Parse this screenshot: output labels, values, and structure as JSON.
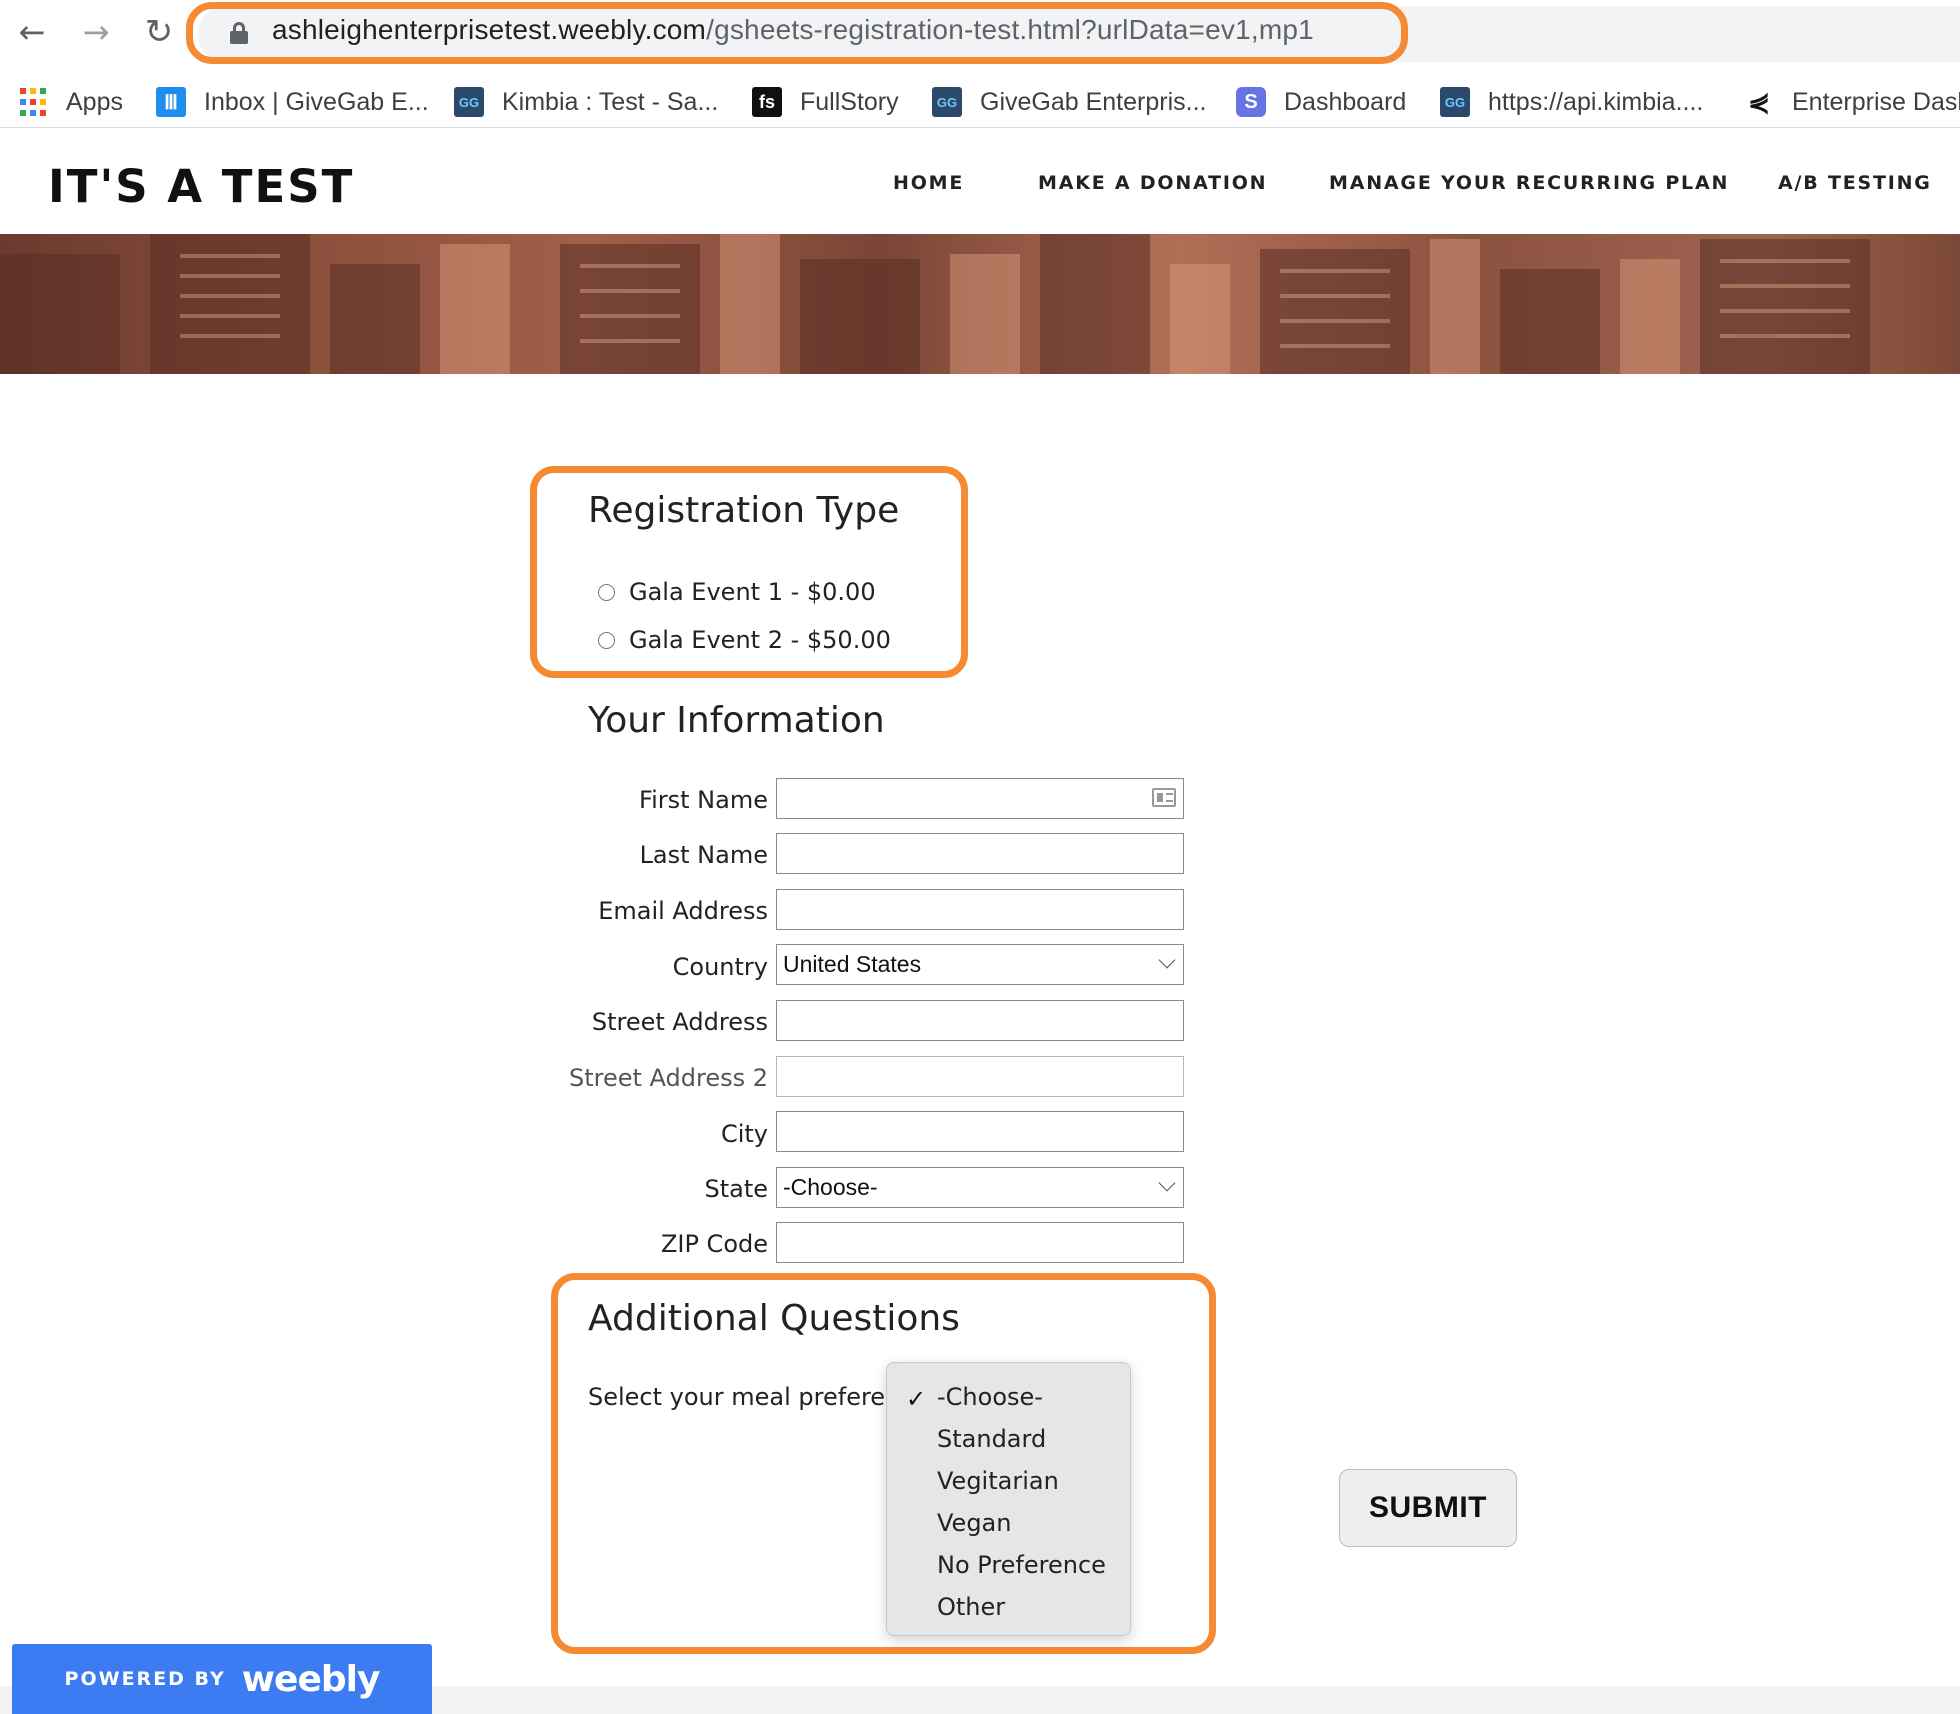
{
  "browser": {
    "url_domain": "ashleighenterprisetest.weebly.com",
    "url_path": "/gsheets-registration-test.html?urlData=ev1,mp1",
    "bookmarks": [
      {
        "label": "Apps",
        "icon": "apps-grid-icon"
      },
      {
        "label": "Inbox | GiveGab E...",
        "icon": "intercom-icon"
      },
      {
        "label": "Kimbia : Test - Sa...",
        "icon": "givegab-icon"
      },
      {
        "label": "FullStory",
        "icon": "fullstory-icon"
      },
      {
        "label": "GiveGab Enterpris...",
        "icon": "givegab-icon"
      },
      {
        "label": "Dashboard",
        "icon": "stripe-icon"
      },
      {
        "label": "https://api.kimbia....",
        "icon": "givegab-icon"
      },
      {
        "label": "Enterprise Dash",
        "icon": "enterprise-icon"
      }
    ],
    "icon_glyphs": {
      "intercom": "Ⅲ",
      "givegab": "GG",
      "fullstory": "fs",
      "stripe": "S",
      "enterprise": "⋞"
    }
  },
  "site": {
    "title": "IT'S A TEST",
    "nav": [
      "HOME",
      "MAKE A DONATION",
      "MANAGE YOUR RECURRING PLAN",
      "A/B TESTING"
    ]
  },
  "form": {
    "registration_title": "Registration Type",
    "registration_options": [
      "Gala Event 1 - $0.00",
      "Gala Event 2 - $50.00"
    ],
    "info_title": "Your Information",
    "fields": [
      {
        "label": "First Name",
        "value": ""
      },
      {
        "label": "Last Name",
        "value": ""
      },
      {
        "label": "Email Address",
        "value": ""
      },
      {
        "label": "Country",
        "value": "United States"
      },
      {
        "label": "Street Address",
        "value": ""
      },
      {
        "label": "Street Address 2",
        "value": ""
      },
      {
        "label": "City",
        "value": ""
      },
      {
        "label": "State",
        "value": "-Choose-"
      },
      {
        "label": "ZIP Code",
        "value": ""
      }
    ],
    "additional_title": "Additional Questions",
    "meal_label": "Select your meal preference",
    "meal_options": [
      "-Choose-",
      "Standard",
      "Vegitarian",
      "Vegan",
      "No Preference",
      "Other"
    ],
    "check_glyph": "✓",
    "submit_label": "SUBMIT"
  },
  "footer": {
    "powered_by": "POWERED BY",
    "brand": "weebly"
  },
  "colors": {
    "highlight": "#f58a32",
    "weebly_blue": "#3d7bf2"
  }
}
